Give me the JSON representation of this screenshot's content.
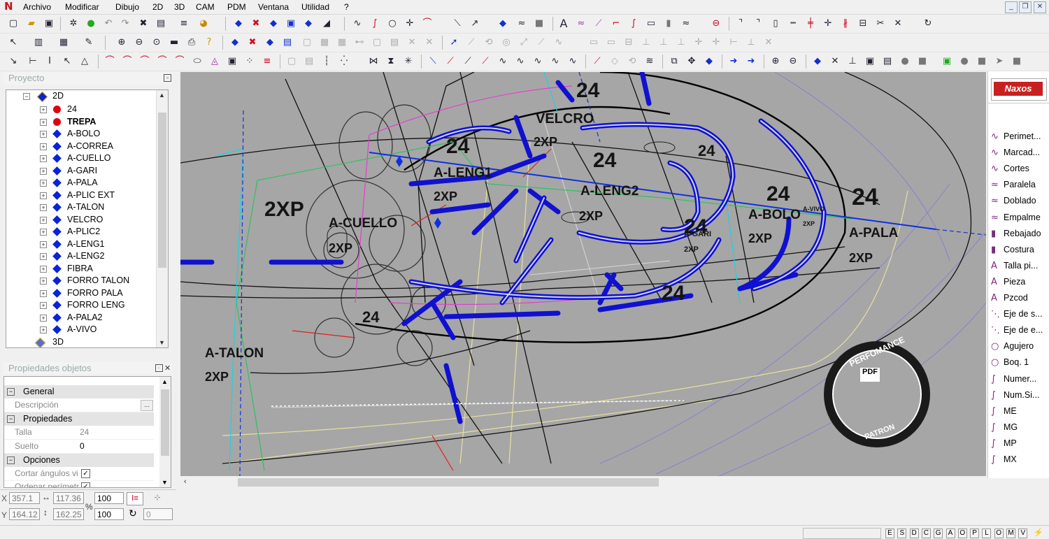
{
  "menu": {
    "items": [
      "Archivo",
      "Modificar",
      "Dibujo",
      "2D",
      "3D",
      "CAM",
      "PDM",
      "Ventana",
      "Utilidad",
      "?"
    ]
  },
  "project": {
    "title": "Proyecto",
    "root": "2D",
    "items": [
      {
        "label": "24",
        "type": "dot"
      },
      {
        "label": "TREPA",
        "type": "dot",
        "bold": true
      },
      {
        "label": "A-BOLO",
        "type": "dia"
      },
      {
        "label": "A-CORREA",
        "type": "dia"
      },
      {
        "label": "A-CUELLO",
        "type": "dia"
      },
      {
        "label": "A-GARI",
        "type": "dia"
      },
      {
        "label": "A-PALA",
        "type": "dia"
      },
      {
        "label": "A-PLIC EXT",
        "type": "dia"
      },
      {
        "label": "A-TALON",
        "type": "dia"
      },
      {
        "label": "VELCRO",
        "type": "dia"
      },
      {
        "label": "A-PLIC2",
        "type": "dia"
      },
      {
        "label": "A-LENG1",
        "type": "dia"
      },
      {
        "label": "A-LENG2",
        "type": "dia"
      },
      {
        "label": "FIBRA",
        "type": "dia"
      },
      {
        "label": "FORRO TALON",
        "type": "dia"
      },
      {
        "label": "FORRO PALA",
        "type": "dia"
      },
      {
        "label": "FORRO LENG",
        "type": "dia"
      },
      {
        "label": "A-PALA2",
        "type": "dia"
      },
      {
        "label": "A-VIVO",
        "type": "dia"
      }
    ],
    "last": "3D"
  },
  "properties": {
    "title": "Propiedades objetos",
    "sections": {
      "general": "General",
      "props": "Propiedades",
      "options": "Opciones"
    },
    "descripcion_label": "Descripción",
    "talla_label": "Talla",
    "talla_value": "24",
    "suelto_label": "Suelto",
    "suelto_value": "0",
    "cortar_label": "Cortar ángulos vi",
    "ordenar_label": "Ordenar perímetr"
  },
  "coords": {
    "x_label": "X",
    "x_value": "357.1",
    "y_label": "Y",
    "y_value": "164.12",
    "dx_value": "117.36",
    "dy_value": "162.25",
    "pct_label": "%",
    "scale1": "100",
    "scale2": "100",
    "angle": "0"
  },
  "right_panel": {
    "logo": "Naxos",
    "items": [
      {
        "label": "Perimet...",
        "icon": "∿"
      },
      {
        "label": "Marcad...",
        "icon": "∿"
      },
      {
        "label": "Cortes",
        "icon": "∿"
      },
      {
        "label": "Paralela",
        "icon": "≈"
      },
      {
        "label": "Doblado",
        "icon": "≈"
      },
      {
        "label": "Empalme",
        "icon": "≈"
      },
      {
        "label": "Rebajado",
        "icon": "▮"
      },
      {
        "label": "Costura",
        "icon": "▮"
      },
      {
        "label": "Talla pi...",
        "icon": "A"
      },
      {
        "label": "Pieza",
        "icon": "A"
      },
      {
        "label": "Pzcod",
        "icon": "A"
      },
      {
        "label": "Eje de s...",
        "icon": "⋱"
      },
      {
        "label": "Eje de e...",
        "icon": "⋱"
      },
      {
        "label": "Agujero",
        "icon": "○"
      },
      {
        "label": "Boq. 1",
        "icon": "○"
      },
      {
        "label": "Numer...",
        "icon": "∫"
      },
      {
        "label": "Num.Si...",
        "icon": "∫"
      },
      {
        "label": "ME",
        "icon": "∫"
      },
      {
        "label": "MG",
        "icon": "∫"
      },
      {
        "label": "MP",
        "icon": "∫"
      },
      {
        "label": "MX",
        "icon": "∫"
      }
    ]
  },
  "canvas": {
    "labels": [
      {
        "t": "24"
      },
      {
        "t": "24"
      },
      {
        "t": "24"
      },
      {
        "t": "24"
      },
      {
        "t": "24"
      },
      {
        "t": "24"
      },
      {
        "t": "24"
      },
      {
        "t": "24"
      },
      {
        "t": "24"
      },
      {
        "t": "VELCRO"
      },
      {
        "t": "2XP"
      },
      {
        "t": "A-LENG1"
      },
      {
        "t": "2XP"
      },
      {
        "t": "A-LENG2"
      },
      {
        "t": "2XP"
      },
      {
        "t": "A-CUELLO"
      },
      {
        "t": "2XP"
      },
      {
        "t": "A-BOLO"
      },
      {
        "t": "2XP"
      },
      {
        "t": "A-PALA"
      },
      {
        "t": "2XP"
      },
      {
        "t": "A-TALON"
      },
      {
        "t": "2XP"
      },
      {
        "t": "A-GARI"
      },
      {
        "t": "2XP"
      },
      {
        "t": "A-VIVO"
      },
      {
        "t": "2XP"
      },
      {
        "t": "2XP"
      }
    ],
    "watermark": {
      "top": "PERFOMANCE",
      "mid": "PDF",
      "bottom": "PATRON"
    }
  },
  "status_letters": [
    "E",
    "S",
    "D",
    "C",
    "G",
    "A",
    "O",
    "P",
    "L",
    "O",
    "M",
    "V"
  ],
  "colors": {
    "accent_blue": "#1010e0",
    "canvas_bg": "#a6a6a6",
    "tree_dot": "#e00010",
    "tree_diamond": "#0a22d8"
  }
}
